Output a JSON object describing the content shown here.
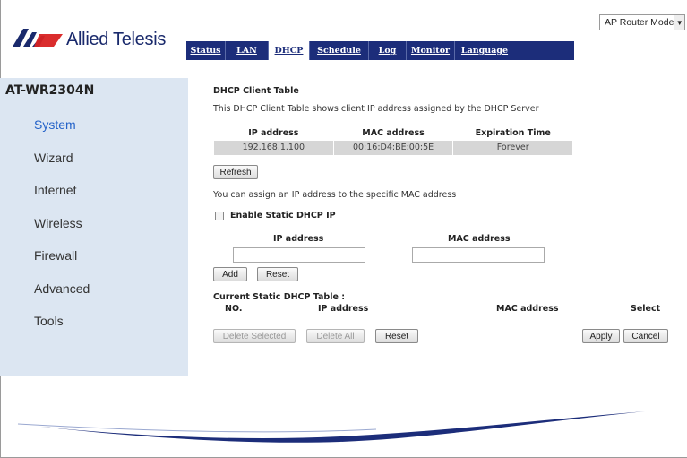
{
  "brand": {
    "logo_text": "Allied Telesis",
    "logo_icon": "allied-telesis-logo-icon"
  },
  "mode_select": {
    "value": "AP Router Mode"
  },
  "nav": {
    "items": [
      "Status",
      "LAN",
      "DHCP",
      "Schedule",
      "Log",
      "Monitor",
      "Language"
    ],
    "active": "DHCP"
  },
  "sidebar": {
    "model": "AT-WR2304N",
    "items": [
      "System",
      "Wizard",
      "Internet",
      "Wireless",
      "Firewall",
      "Advanced",
      "Tools"
    ],
    "active": "System"
  },
  "main": {
    "client_table_title": "DHCP Client Table",
    "client_table_desc": "This DHCP Client Table shows client IP address assigned by the DHCP Server",
    "client_table": {
      "headers": [
        "IP address",
        "MAC address",
        "Expiration Time"
      ],
      "rows": [
        [
          "192.168.1.100",
          "00:16:D4:BE:00:5E",
          "Forever"
        ]
      ]
    },
    "refresh_label": "Refresh",
    "assign_desc": "You can assign an IP address to the specific MAC address",
    "enable_static_label": "Enable Static DHCP IP",
    "enable_static_checked": false,
    "ip_label": "IP address",
    "mac_label": "MAC address",
    "ip_value": "",
    "mac_value": "",
    "add_label": "Add",
    "reset_label": "Reset",
    "static_table_title": "Current Static DHCP Table :",
    "static_headers": {
      "no": "NO.",
      "ip": "IP address",
      "mac": "MAC address",
      "select": "Select"
    },
    "delete_selected_label": "Delete Selected",
    "delete_all_label": "Delete All",
    "reset2_label": "Reset",
    "apply_label": "Apply",
    "cancel_label": "Cancel"
  },
  "colors": {
    "nav_bg": "#1c2d7a",
    "sidebar_bg": "#dce6f2",
    "active_menu": "#2563c9",
    "table_cell_bg": "#d6d6d6",
    "swoosh": "#1c2d7a"
  }
}
